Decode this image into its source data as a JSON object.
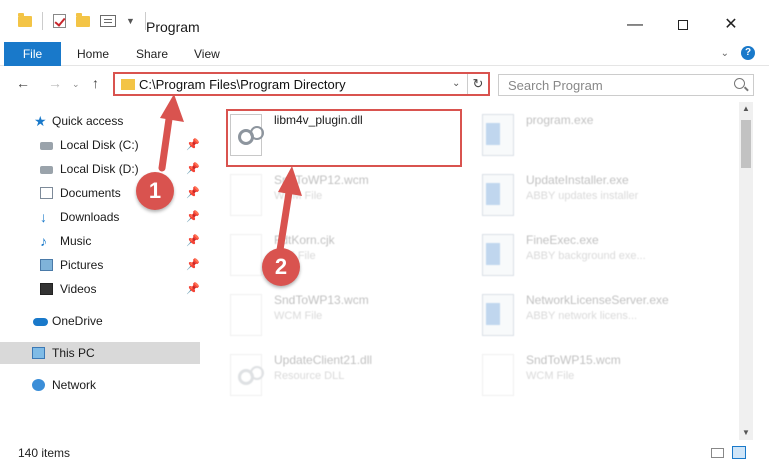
{
  "window": {
    "title": "Program",
    "minimize": "—",
    "close": "✕"
  },
  "ribbon": {
    "tabs": [
      "File",
      "Home",
      "Share",
      "View"
    ],
    "help": "?",
    "expand": "⌄"
  },
  "nav": {
    "back": "←",
    "forward": "→",
    "recent": "⌄",
    "up": "↑"
  },
  "address": {
    "path": "C:\\Program Files\\Program Directory",
    "dropdown": "⌄",
    "refresh": "↻"
  },
  "search": {
    "placeholder": "Search Program"
  },
  "sidebar": {
    "items": [
      {
        "label": "Quick access",
        "icon": "star-icon"
      },
      {
        "label": "Local Disk (C:)",
        "icon": "disk-icon",
        "pinned": true
      },
      {
        "label": "Local Disk (D:)",
        "icon": "disk-icon",
        "pinned": true
      },
      {
        "label": "Documents",
        "icon": "documents-icon",
        "pinned": true
      },
      {
        "label": "Downloads",
        "icon": "download-icon",
        "pinned": true
      },
      {
        "label": "Music",
        "icon": "music-icon",
        "pinned": true
      },
      {
        "label": "Pictures",
        "icon": "pictures-icon",
        "pinned": true
      },
      {
        "label": "Videos",
        "icon": "videos-icon",
        "pinned": true
      },
      {
        "label": "OneDrive",
        "icon": "cloud-icon"
      },
      {
        "label": "This PC",
        "icon": "pc-icon",
        "selected": true
      },
      {
        "label": "Network",
        "icon": "network-icon"
      }
    ]
  },
  "files": {
    "highlighted": {
      "name": "libm4v_plugin.dll",
      "type": ""
    },
    "items": [
      {
        "name": "program.exe",
        "type": ""
      },
      {
        "name": "SndToWP12.wcm",
        "type": "WCM File"
      },
      {
        "name": "UpdateInstaller.exe",
        "type": "ABBY updates installer"
      },
      {
        "name": "FdtKorn.cjk",
        "type": "CJK File"
      },
      {
        "name": "FineExec.exe",
        "type": "ABBY background exe..."
      },
      {
        "name": "SndToWP13.wcm",
        "type": "WCM File"
      },
      {
        "name": "NetworkLicenseServer.exe",
        "type": "ABBY network licens..."
      },
      {
        "name": "UpdateClient21.dll",
        "type": "Resource DLL"
      },
      {
        "name": "SndToWP15.wcm",
        "type": "WCM File"
      }
    ]
  },
  "status": {
    "item_count": "140 items"
  },
  "annotations": {
    "marker1": "1",
    "marker2": "2",
    "color": "#d9534f"
  },
  "colors": {
    "accent": "#1979ca",
    "highlight": "#d9534f",
    "folder": "#f3c446"
  }
}
